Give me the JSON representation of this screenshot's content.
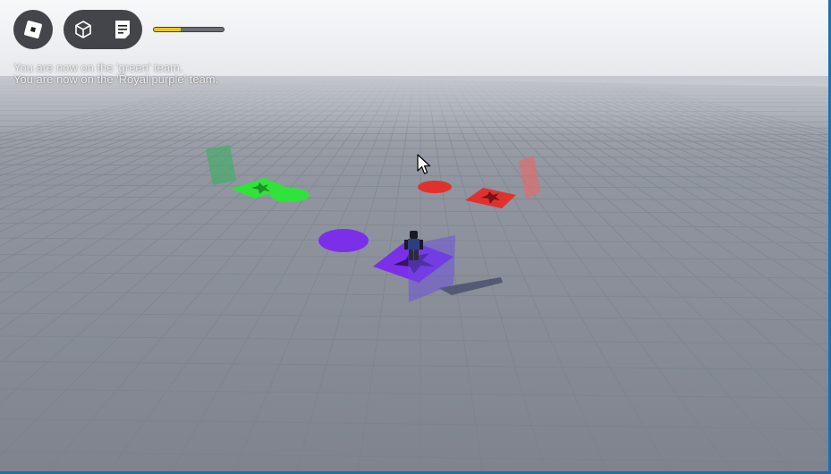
{
  "hud": {
    "menu_icon": "roblox-logo-icon",
    "tool_icons": [
      "cube-icon",
      "chat-bubble-icon"
    ],
    "health_fraction": 0.38,
    "health_color": "#e9c61f"
  },
  "chat": {
    "messages": [
      "You are now on the 'green' team.",
      "You are now on the 'Royal purple' team."
    ]
  },
  "scene": {
    "teams": [
      {
        "name": "green",
        "color": "#2fe33a"
      },
      {
        "name": "red",
        "color": "#e0312f"
      },
      {
        "name": "Royal purple",
        "color": "#7c2fe8"
      }
    ]
  }
}
